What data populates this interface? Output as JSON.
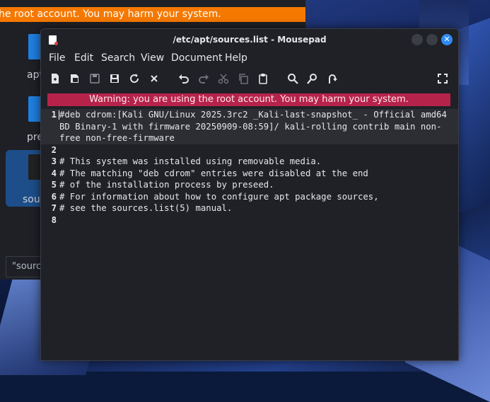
{
  "background_window": {
    "warning_text": "he root account. You may harm your system.",
    "items": [
      {
        "label": "apt"
      },
      {
        "label": "prefe"
      },
      {
        "label": "sour"
      }
    ],
    "status_text": "\"sourc"
  },
  "window": {
    "title": "/etc/apt/sources.list - Mousepad",
    "close_symbol": "✕"
  },
  "menu": {
    "items": [
      "File",
      "Edit",
      "Search",
      "View",
      "Document",
      "Help"
    ]
  },
  "toolbar": {
    "icons": [
      "new-document-icon",
      "new-window-icon",
      "save-icon",
      "save-as-icon",
      "reload-icon",
      "close-icon",
      "undo-icon",
      "redo-icon",
      "cut-icon",
      "copy-icon",
      "paste-icon",
      "search-icon",
      "replace-icon",
      "go-to-line-icon",
      "fullscreen-icon"
    ]
  },
  "warning": {
    "text": "Warning: you are using the root account. You may harm your system."
  },
  "editor": {
    "lines": [
      {
        "num": "1",
        "text": "#deb cdrom:[Kali GNU/Linux 2025.3rc2 _Kali-last-snapshot_ - Official amd64"
      },
      {
        "num": "",
        "text": "BD Binary-1 with firmware 20250909-08:59]/ kali-rolling contrib main non-"
      },
      {
        "num": "",
        "text": "free non-free-firmware"
      },
      {
        "num": "2",
        "text": ""
      },
      {
        "num": "3",
        "text": "# This system was installed using removable media."
      },
      {
        "num": "4",
        "text": "# The matching \"deb cdrom\" entries were disabled at the end"
      },
      {
        "num": "5",
        "text": "# of the installation process by preseed."
      },
      {
        "num": "6",
        "text": "# For information about how to configure apt package sources,"
      },
      {
        "num": "7",
        "text": "# see the sources.list(5) manual."
      },
      {
        "num": "8",
        "text": ""
      }
    ]
  }
}
